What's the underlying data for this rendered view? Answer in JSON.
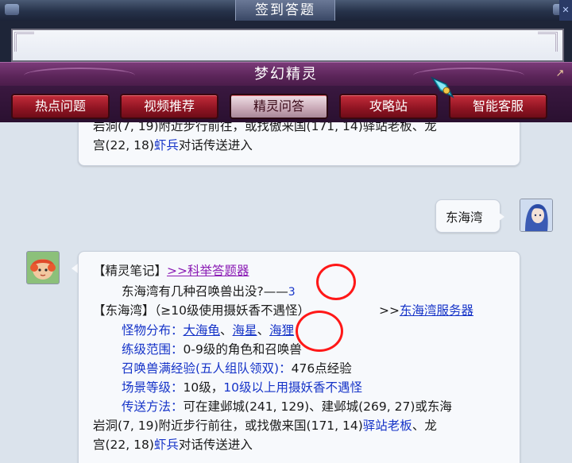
{
  "window": {
    "title": "签到答题"
  },
  "header": {
    "title": "梦幻精灵"
  },
  "tabs": [
    {
      "label": "热点问题",
      "active": false
    },
    {
      "label": "视频推荐",
      "active": false
    },
    {
      "label": "精灵问答",
      "active": true
    },
    {
      "label": "攻略站",
      "active": false
    },
    {
      "label": "智能客服",
      "active": false
    }
  ],
  "chat": {
    "prev_message": {
      "line1": "岩洞(7, 19)附近步行前往，或找傲来国(171, 14)驿站老板、龙",
      "line2_pre": "宫(22, 18)",
      "line2_link": "虾兵",
      "line2_post": "对话传送进入"
    },
    "user_message": "东海湾",
    "reply": {
      "note_label": "【精灵笔记】",
      "note_link": ">>科举答题器",
      "question": "东海湾有几种召唤兽出没?",
      "dash": "——",
      "answer": "3",
      "zone_title": "【东海湾】（≥10级使用摄妖香不遇怪）",
      "server_prefix": ">>",
      "server_link": "东海湾服务器",
      "monsters_label": "怪物分布：",
      "monster1": "大海龟",
      "sep1": "、",
      "monster2": "海星",
      "sep2": "、",
      "monster3": "海狸",
      "level_label": "练级范围：",
      "level_value": "0-9级的角色和召唤兽",
      "exp_label": "召唤兽满经验(五人组队领双)：",
      "exp_value": "476点经验",
      "scene_label": "场景等级：",
      "scene_value_pre": "10级，",
      "scene_value_blue": "10级以上用摄妖香不遇怪",
      "travel_label": "传送方法：",
      "travel_line1": "可在建邺城(241, 129)、建邺城(269, 27)或东海",
      "travel_line2_pre": "岩洞(7, 19)附近步行前往，或找傲来国(171, 14)",
      "travel_line2_link": "驿站老板",
      "travel_line2_post": "、龙",
      "travel_line3_pre": "宫(22, 18)",
      "travel_line3_link": "虾兵",
      "travel_line3_post": "对话传送进入"
    }
  },
  "icons": {
    "close": "close-icon",
    "popout": "popout-icon",
    "gem": "gem-icon",
    "user_avatar": "user-avatar",
    "sprite_avatar": "sprite-avatar"
  },
  "colors": {
    "link_blue": "#1634c8",
    "link_purple": "#8a1ab4",
    "highlight_red": "#ff1818",
    "tab_red": "#a81a2a"
  }
}
